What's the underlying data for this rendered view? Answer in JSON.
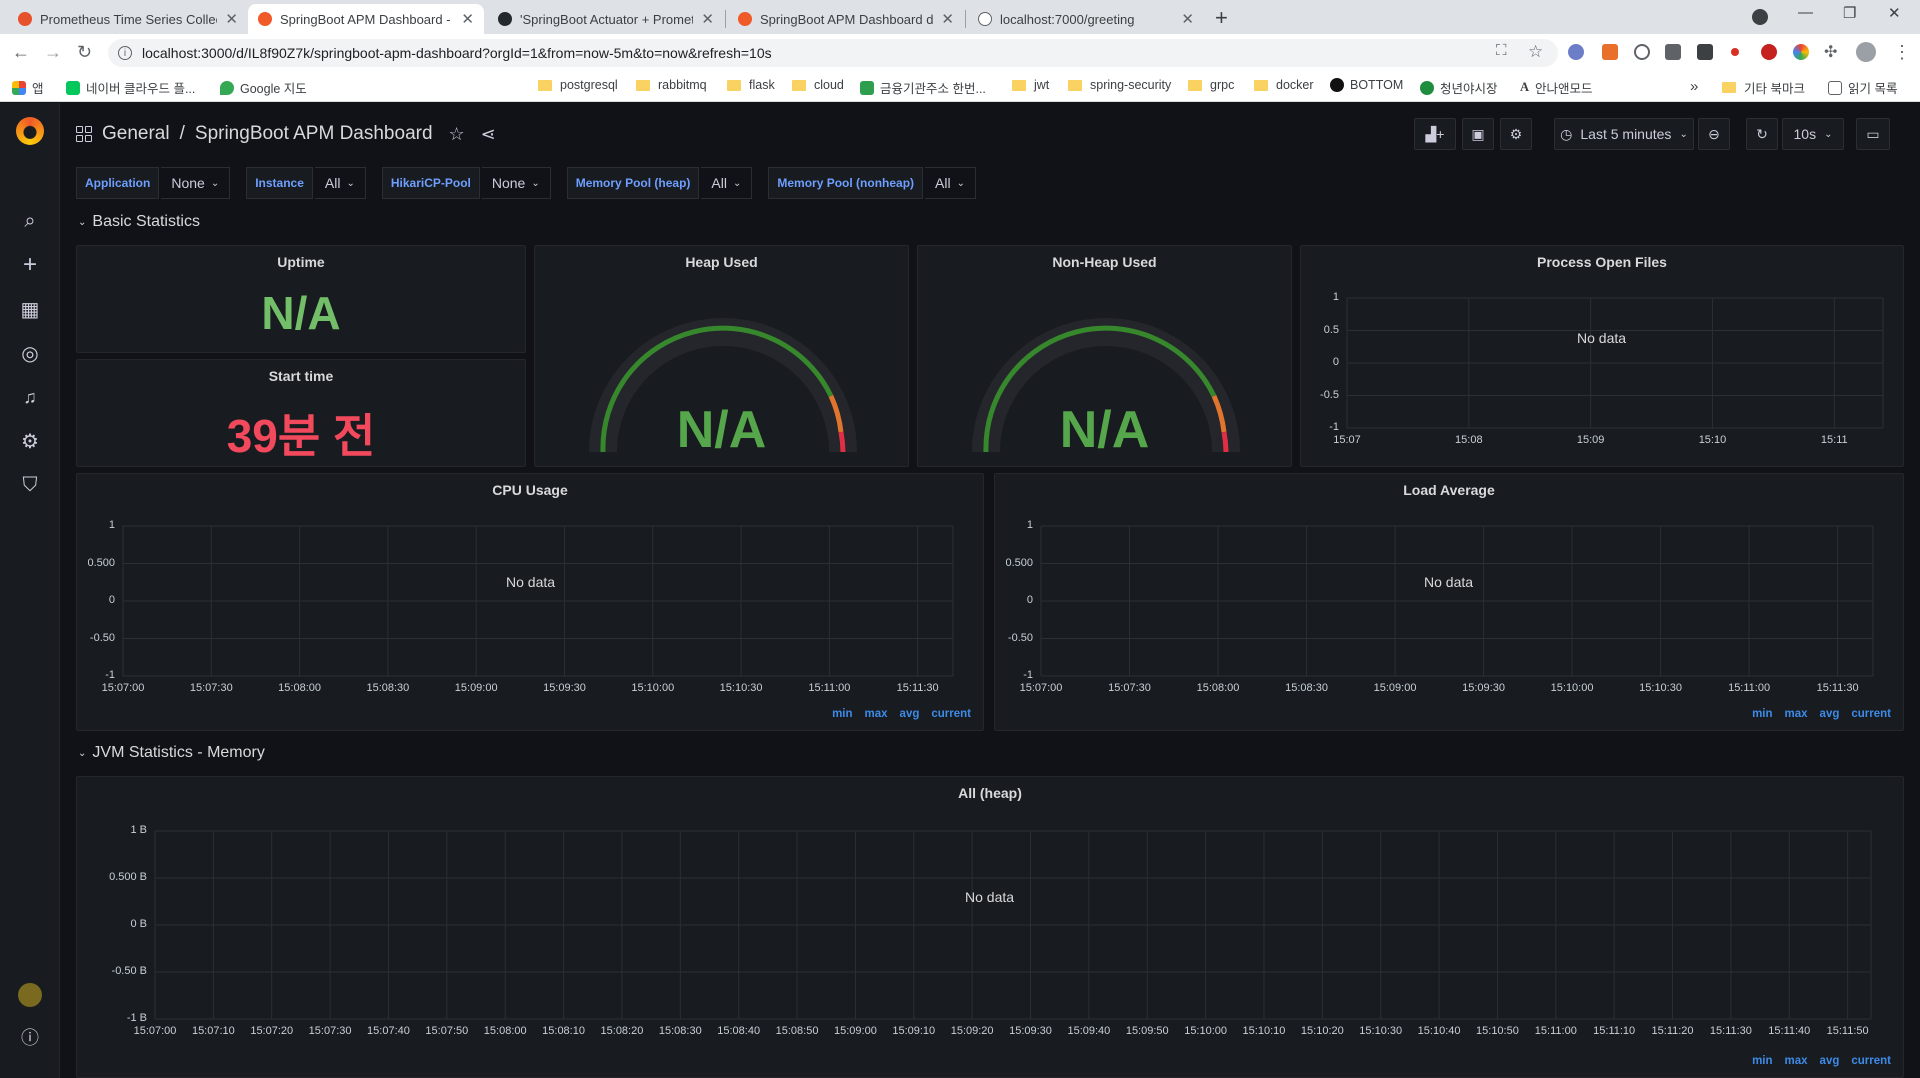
{
  "browser": {
    "tabs": [
      {
        "title": "Prometheus Time Series Collect",
        "color": "#e6522c"
      },
      {
        "title": "SpringBoot APM Dashboard - G",
        "color": "#f05a28"
      },
      {
        "title": "'SpringBoot Actuator + Promet",
        "color": "#24292e"
      },
      {
        "title": "SpringBoot APM Dashboard da",
        "color": "#f05a28"
      },
      {
        "title": "localhost:7000/greeting",
        "color": "#5f6368"
      }
    ],
    "url": "localhost:3000/d/IL8f90Z7k/springboot-apm-dashboard?orgId=1&from=now-5m&to=now&refresh=10s",
    "bookmarks": [
      {
        "label": "앱",
        "type": "apps"
      },
      {
        "label": "네이버 클라우드 플...",
        "type": "site"
      },
      {
        "label": "Google 지도",
        "type": "site"
      },
      {
        "label": "postgresql",
        "type": "folder"
      },
      {
        "label": "rabbitmq",
        "type": "folder"
      },
      {
        "label": "flask",
        "type": "folder"
      },
      {
        "label": "cloud",
        "type": "folder"
      },
      {
        "label": "금융기관주소 한번...",
        "type": "site"
      },
      {
        "label": "jwt",
        "type": "folder"
      },
      {
        "label": "spring-security",
        "type": "folder"
      },
      {
        "label": "grpc",
        "type": "folder"
      },
      {
        "label": "docker",
        "type": "folder"
      },
      {
        "label": "BOTTOM",
        "type": "site"
      },
      {
        "label": "청년야시장",
        "type": "site"
      },
      {
        "label": "안나앤모드",
        "type": "site"
      }
    ],
    "more_bookmarks": "»",
    "other_bookmarks": "기타 북마크",
    "reading_list": "읽기 목록"
  },
  "grafana": {
    "breadcrumb": {
      "folder": "General",
      "separator": "/",
      "dashboard": "SpringBoot APM Dashboard"
    },
    "time_range": "Last 5 minutes",
    "refresh": "10s",
    "variables": [
      {
        "label": "Application",
        "value": "None"
      },
      {
        "label": "Instance",
        "value": "All"
      },
      {
        "label": "HikariCP-Pool",
        "value": "None"
      },
      {
        "label": "Memory Pool (heap)",
        "value": "All"
      },
      {
        "label": "Memory Pool (nonheap)",
        "value": "All"
      }
    ],
    "rows": {
      "basic": "Basic Statistics",
      "jvm": "JVM Statistics - Memory"
    },
    "panels": {
      "uptime": {
        "title": "Uptime",
        "value": "N/A",
        "color": "#73bf69"
      },
      "start_time": {
        "title": "Start time",
        "value": "39분 전",
        "color": "#f2495c"
      },
      "heap": {
        "title": "Heap Used",
        "value": "N/A",
        "color": "#56a64b"
      },
      "nonheap": {
        "title": "Non-Heap Used",
        "value": "N/A",
        "color": "#56a64b"
      },
      "open_files": {
        "title": "Process Open Files",
        "no_data": "No data"
      },
      "cpu": {
        "title": "CPU Usage",
        "no_data": "No data"
      },
      "load": {
        "title": "Load Average",
        "no_data": "No data"
      },
      "heap_all": {
        "title": "All (heap)",
        "no_data": "No data"
      }
    },
    "legend": [
      "min",
      "max",
      "avg",
      "current"
    ]
  },
  "chart_data": [
    {
      "type": "line",
      "title": "Process Open Files",
      "y_ticks": [
        "1",
        "0.5",
        "0",
        "-0.5",
        "-1"
      ],
      "x_ticks": [
        "15:07",
        "15:08",
        "15:09",
        "15:10",
        "15:11"
      ],
      "ylim": [
        -1,
        1
      ],
      "series": []
    },
    {
      "type": "line",
      "title": "CPU Usage",
      "y_ticks": [
        "1",
        "0.500",
        "0",
        "-0.50",
        "-1"
      ],
      "x_ticks": [
        "15:07:00",
        "15:07:30",
        "15:08:00",
        "15:08:30",
        "15:09:00",
        "15:09:30",
        "15:10:00",
        "15:10:30",
        "15:11:00",
        "15:11:30"
      ],
      "ylim": [
        -1,
        1
      ],
      "series": []
    },
    {
      "type": "line",
      "title": "Load Average",
      "y_ticks": [
        "1",
        "0.500",
        "0",
        "-0.50",
        "-1"
      ],
      "x_ticks": [
        "15:07:00",
        "15:07:30",
        "15:08:00",
        "15:08:30",
        "15:09:00",
        "15:09:30",
        "15:10:00",
        "15:10:30",
        "15:11:00",
        "15:11:30"
      ],
      "ylim": [
        -1,
        1
      ],
      "series": []
    },
    {
      "type": "line",
      "title": "All (heap)",
      "y_ticks": [
        "1 B",
        "0.500 B",
        "0 B",
        "-0.50 B",
        "-1 B"
      ],
      "x_ticks": [
        "15:07:00",
        "15:07:10",
        "15:07:20",
        "15:07:30",
        "15:07:40",
        "15:07:50",
        "15:08:00",
        "15:08:10",
        "15:08:20",
        "15:08:30",
        "15:08:40",
        "15:08:50",
        "15:09:00",
        "15:09:10",
        "15:09:20",
        "15:09:30",
        "15:09:40",
        "15:09:50",
        "15:10:00",
        "15:10:10",
        "15:10:20",
        "15:10:30",
        "15:10:40",
        "15:10:50",
        "15:11:00",
        "15:11:10",
        "15:11:20",
        "15:11:30",
        "15:11:40",
        "15:11:50"
      ],
      "ylim": [
        -1,
        1
      ],
      "series": []
    }
  ]
}
